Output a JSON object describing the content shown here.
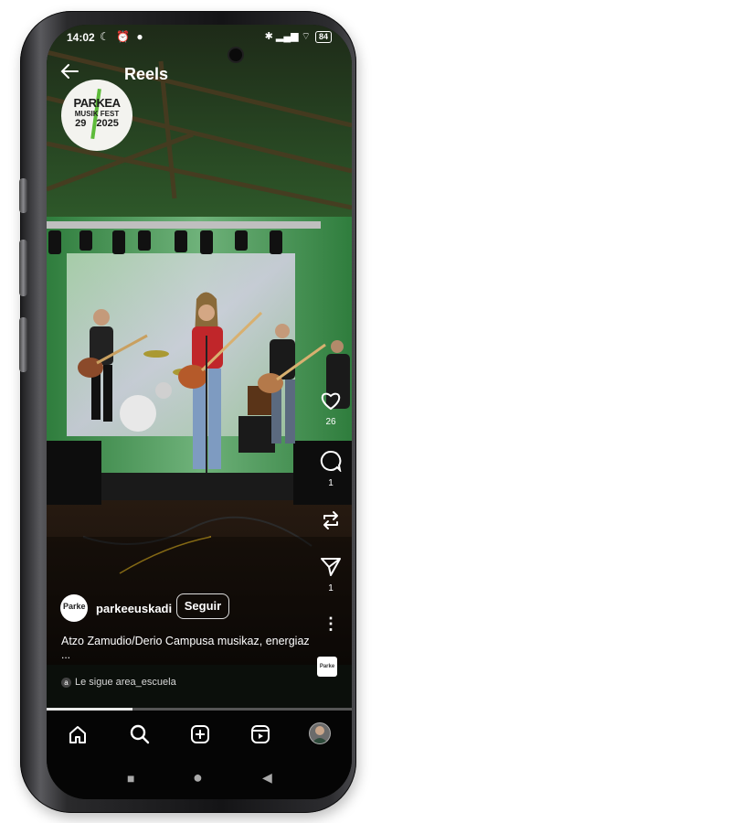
{
  "status_bar": {
    "time": "14:02",
    "left_icons": "☾ ⏰ ●",
    "right_icons": "✱ ▂▄▆ ⌔",
    "battery": "84"
  },
  "header": {
    "back_icon": "arrow-left-icon",
    "title": "Reels"
  },
  "logo": {
    "line1": "PARKEA",
    "line2": "MUSIK FEST",
    "line3": "29",
    "line4": "2025"
  },
  "rail": {
    "like_count": "26",
    "comment_count": "1",
    "share_count": "1",
    "more_icon": "⋮"
  },
  "post": {
    "avatar_text": "Parke",
    "account_name": "parkeeuskadi",
    "follow_label": "Seguir",
    "caption": "Atzo Zamudio/Derio Campusa musikaz, energiaz",
    "caption_more": "...",
    "followed_by": "Le sigue area_escuela",
    "followed_icon": "a",
    "audio_thumb": "Parke"
  },
  "progress": {
    "fraction": 0.28
  },
  "nav": {
    "home": "home-icon",
    "search": "search-icon",
    "create": "add-icon",
    "reels": "reels-icon",
    "profile": "profile-avatar"
  },
  "system_nav": {
    "recents": "■",
    "home": "●",
    "back": "◀"
  },
  "colors": {
    "stage_green": "#3f8a4c",
    "screen_bg": "#0b0f0b",
    "nav_bg": "#050505"
  }
}
